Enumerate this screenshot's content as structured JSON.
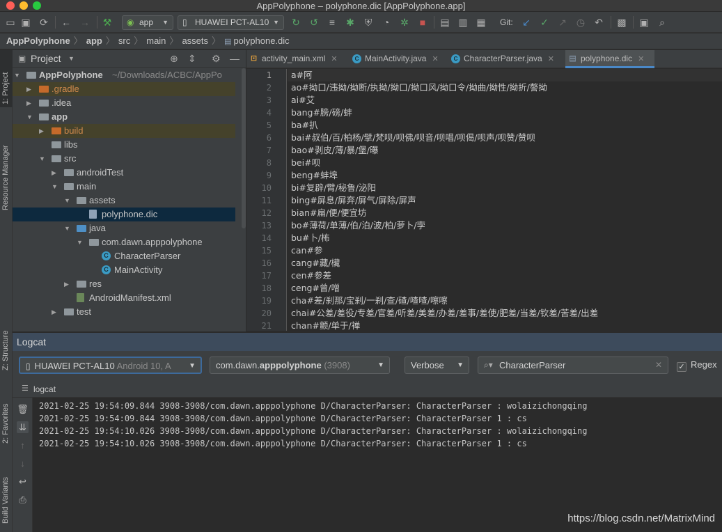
{
  "window": {
    "title": "AppPolyphone – polyphone.dic [AppPolyphone.app]"
  },
  "toolbar": {
    "module": "app",
    "device": "HUAWEI PCT-AL10",
    "git_label": "Git:"
  },
  "breadcrumb": [
    "AppPolyphone",
    "app",
    "src",
    "main",
    "assets",
    "polyphone.dic"
  ],
  "left_strip": {
    "project": "1: Project",
    "resource_manager": "Resource Manager",
    "structure": "Z: Structure",
    "favorites": "2: Favorites",
    "build_variants": "Build Variants"
  },
  "project_panel": {
    "title": "Project",
    "tree": [
      {
        "label": "AppPolyphone",
        "extra": " ~/Downloads/ACBC/AppPo",
        "level": 0,
        "arrow": "▼",
        "kind": "module",
        "bold": true
      },
      {
        "label": ".gradle",
        "level": 1,
        "arrow": "▶",
        "kind": "folder-orange",
        "highlight": true
      },
      {
        "label": ".idea",
        "level": 1,
        "arrow": "▶",
        "kind": "folder"
      },
      {
        "label": "app",
        "level": 1,
        "arrow": "▼",
        "kind": "module",
        "bold": true
      },
      {
        "label": "build",
        "level": 2,
        "arrow": "▶",
        "kind": "folder-orange",
        "highlight": true
      },
      {
        "label": "libs",
        "level": 2,
        "arrow": "",
        "kind": "folder"
      },
      {
        "label": "src",
        "level": 2,
        "arrow": "▼",
        "kind": "folder"
      },
      {
        "label": "androidTest",
        "level": 3,
        "arrow": "▶",
        "kind": "folder"
      },
      {
        "label": "main",
        "level": 3,
        "arrow": "▼",
        "kind": "folder"
      },
      {
        "label": "assets",
        "level": 4,
        "arrow": "▼",
        "kind": "folder-res"
      },
      {
        "label": "polyphone.dic",
        "level": 5,
        "arrow": "",
        "kind": "file",
        "selected": true
      },
      {
        "label": "java",
        "level": 4,
        "arrow": "▼",
        "kind": "folder-blue"
      },
      {
        "label": "com.dawn.apppolyphone",
        "level": 5,
        "arrow": "▼",
        "kind": "package"
      },
      {
        "label": "CharacterParser",
        "level": 6,
        "arrow": "",
        "kind": "class"
      },
      {
        "label": "MainActivity",
        "level": 6,
        "arrow": "",
        "kind": "class"
      },
      {
        "label": "res",
        "level": 4,
        "arrow": "▶",
        "kind": "folder-res"
      },
      {
        "label": "AndroidManifest.xml",
        "level": 4,
        "arrow": "",
        "kind": "manifest"
      },
      {
        "label": "test",
        "level": 3,
        "arrow": "▶",
        "kind": "folder"
      }
    ]
  },
  "editor": {
    "tabs": [
      {
        "label": "activity_main.xml",
        "icon": "xml",
        "active": false
      },
      {
        "label": "MainActivity.java",
        "icon": "class",
        "active": false
      },
      {
        "label": "CharacterParser.java",
        "icon": "class",
        "active": false
      },
      {
        "label": "polyphone.dic",
        "icon": "file",
        "active": true
      }
    ],
    "lines": [
      "a#阿",
      "ao#拗口/违拗/拗断/执拗/拗口/拗口风/拗口令/拗曲/拗性/拗折/謷拗",
      "ai#艾",
      "bang#膀/磅/蚌",
      "ba#扒",
      "bai#叔伯/百/柏杨/擘/梵呗/呗佛/呗音/呗唱/呗偈/呗声/呗赞/赞呗",
      "bao#剥皮/薄/暴/堡/曝",
      "bei#呗",
      "beng#蚌埠",
      "bi#复辟/臂/秘鲁/泌阳",
      "bing#屏息/屏弃/屏气/屏除/屏声",
      "bian#扁/便/便宜坊",
      "bo#薄荷/单薄/伯/泊/波/柏/萝卜/孛",
      "bu#卜/柨",
      "can#参",
      "cang#藏/欌",
      "cen#参差",
      "ceng#曾/噌",
      "cha#差/刹那/宝刹/一刹/查/碴/喳喳/嚓嚓",
      "chai#公差/差役/专差/官差/听差/美差/办差/差事/差使/肥差/当差/钦差/苦差/出差",
      "chan#颤/单于/禅"
    ]
  },
  "logcat": {
    "title": "Logcat",
    "device": "HUAWEI PCT-AL10",
    "device_sub": "Android 10, A",
    "process": "com.dawn.",
    "process_bold": "apppolyphone",
    "process_pid": "(3908)",
    "level": "Verbose",
    "search": "CharacterParser",
    "regex_label": "Regex",
    "sub_label": "logcat",
    "lines": [
      "2021-02-25 19:54:09.844 3908-3908/com.dawn.apppolyphone D/CharacterParser: CharacterParser : wolaizichongqing",
      "2021-02-25 19:54:09.844 3908-3908/com.dawn.apppolyphone D/CharacterParser: CharacterParser 1 : cs",
      "2021-02-25 19:54:10.026 3908-3908/com.dawn.apppolyphone D/CharacterParser: CharacterParser : wolaizichongqing",
      "2021-02-25 19:54:10.026 3908-3908/com.dawn.apppolyphone D/CharacterParser: CharacterParser 1 : cs"
    ]
  },
  "watermark": "https://blog.csdn.net/MatrixMind",
  "colors": {
    "accent": "#4a88c7",
    "selection": "#0d293e",
    "ignored_folder": "#c56a2b",
    "class_icon": "#3a9bc4"
  }
}
